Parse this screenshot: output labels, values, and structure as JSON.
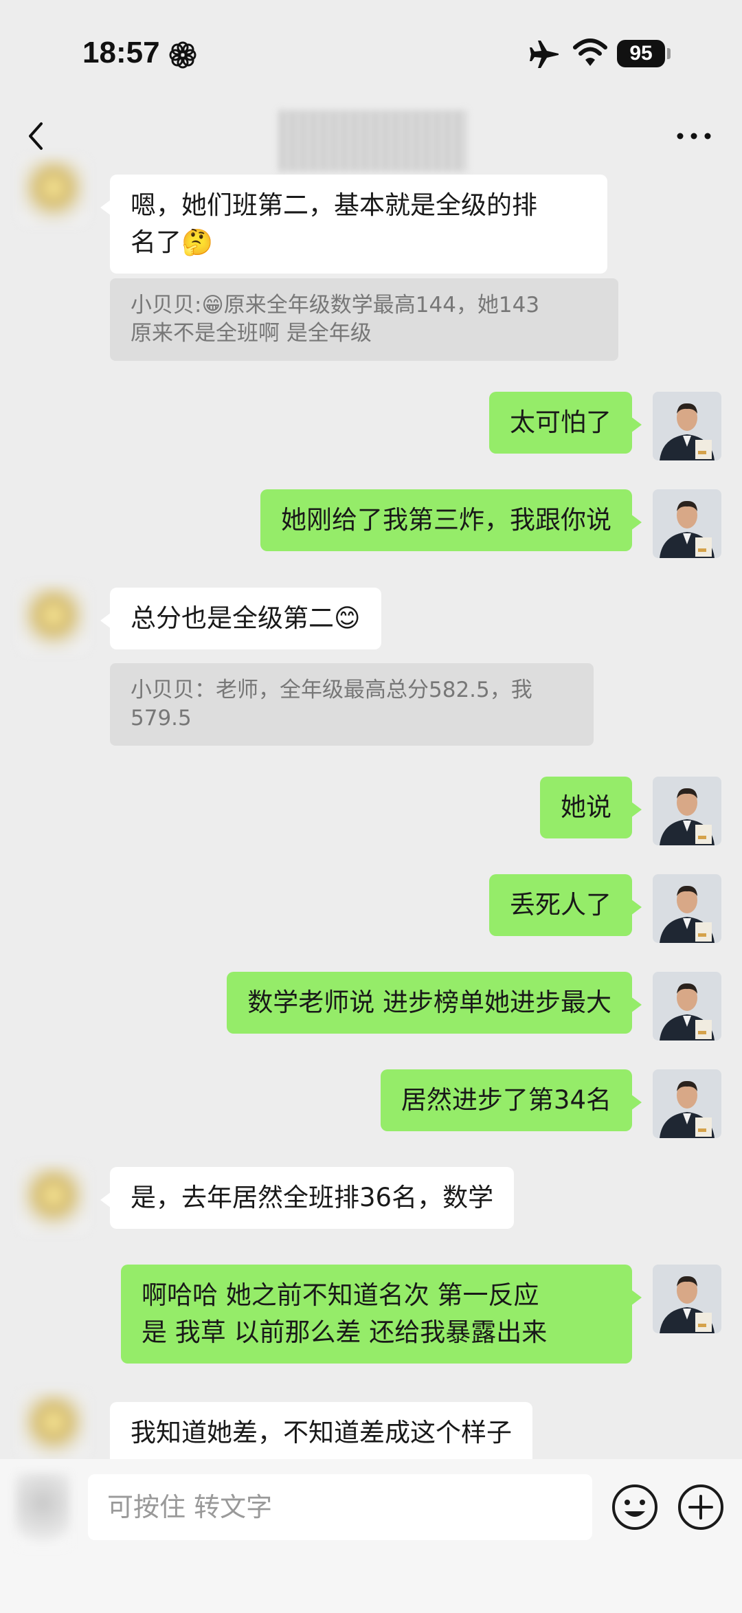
{
  "status_bar": {
    "time": "18:57",
    "battery": "95"
  },
  "nav": {
    "title": "████████"
  },
  "messages": [
    {
      "side": "in",
      "text_lines": [
        "嗯，她们班第二，基本就是全级的排",
        "名了🤔"
      ]
    },
    {
      "type": "quote",
      "lines": [
        "小贝贝:😁原来全年级数学最高144，她143",
        "原来不是全班啊 是全年级"
      ]
    },
    {
      "side": "out",
      "text": "太可怕了"
    },
    {
      "side": "out",
      "text": "她刚给了我第三炸，我跟你说"
    },
    {
      "side": "in",
      "text": "总分也是全级第二😊"
    },
    {
      "type": "quote",
      "lines": [
        "小贝贝：老师，全年级最高总分582.5，我",
        "579.5"
      ]
    },
    {
      "side": "out",
      "text": "她说"
    },
    {
      "side": "out",
      "text": "丢死人了"
    },
    {
      "side": "out",
      "text": "数学老师说 进步榜单她进步最大"
    },
    {
      "side": "out",
      "text": "居然进步了第34名"
    },
    {
      "side": "in",
      "text": "是，去年居然全班排36名，数学"
    },
    {
      "side": "out",
      "text_lines": [
        "啊哈哈   她之前不知道名次  第一反应",
        "是   我草 以前那么差  还给我暴露出来"
      ]
    },
    {
      "side": "in",
      "text": "我知道她差，不知道差成这个样子"
    }
  ],
  "input_bar": {
    "placeholder": "可按住 转文字"
  },
  "icons": {
    "back": "chevron-left-icon",
    "more": "more-dots-icon",
    "emoji": "smiley-icon",
    "plus": "plus-circle-icon",
    "airplane": "airplane-icon",
    "wifi": "wifi-icon",
    "flower": "flower-icon"
  },
  "colors": {
    "background": "#ededed",
    "outgoing_bubble": "#95ec69",
    "incoming_bubble": "#ffffff",
    "quote_bg": "#dddddd"
  }
}
